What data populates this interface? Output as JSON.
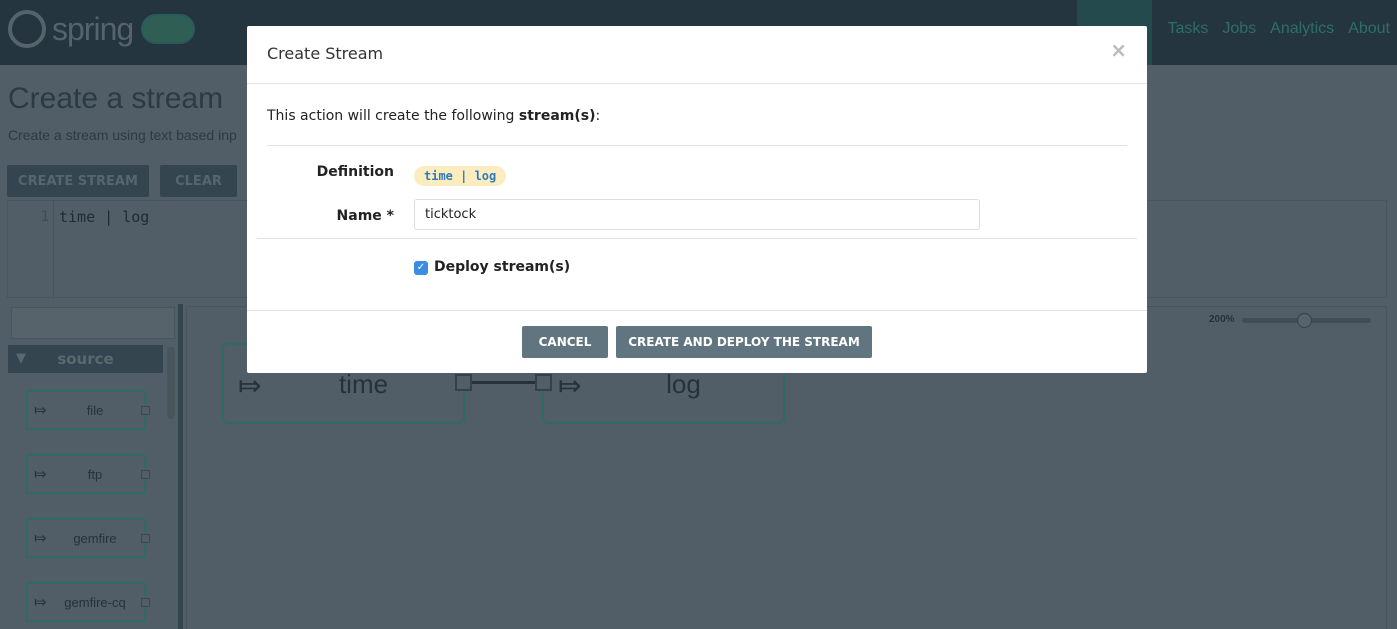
{
  "nav": {
    "brand": "spring",
    "items": [
      "Tasks",
      "Jobs",
      "Analytics",
      "About"
    ]
  },
  "page": {
    "title": "Create a stream",
    "subtitle": "Create a stream using text based inp",
    "create_label": "CREATE STREAM",
    "clear_label": "CLEAR"
  },
  "editor": {
    "line_number": "1",
    "code": "time | log"
  },
  "palette": {
    "group": "source",
    "items": [
      "file",
      "ftp",
      "gemfire",
      "gemfire-cq"
    ]
  },
  "canvas": {
    "nodes": [
      "time",
      "log"
    ],
    "zoom": "200%",
    "zoom_level": 200
  },
  "modal": {
    "title": "Create Stream",
    "close": "×",
    "intro_prefix": "This action will create the following ",
    "intro_bold": "stream(s)",
    "intro_suffix": ":",
    "definition_label": "Definition",
    "definition": "time | log",
    "name_label": "Name *",
    "name_value": "ticktock",
    "deploy_label": "Deploy stream(s)",
    "deploy_checked": true,
    "cancel_label": "CANCEL",
    "create_label": "CREATE AND DEPLOY THE STREAM"
  },
  "colors": {
    "checkbox": "#3b8de4",
    "button": "#617580",
    "pill_bg": "#fcecc0",
    "pill_text": "#2f7bb8"
  }
}
